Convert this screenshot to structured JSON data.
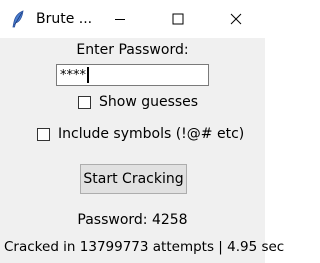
{
  "window": {
    "title": "Brute ...",
    "icon": "feather-icon",
    "controls": [
      "minimize",
      "maximize",
      "close"
    ]
  },
  "form": {
    "prompt_label": "Enter Password:",
    "password_value": "****",
    "show_guesses_label": "Show guesses",
    "show_guesses_checked": false,
    "include_symbols_label": "Include symbols (!@# etc)",
    "include_symbols_checked": false,
    "start_button_label": "Start Cracking"
  },
  "result": {
    "password_text": "Password: 4258",
    "stats_text": "Cracked in 13799773 attempts | 4.95 sec"
  }
}
